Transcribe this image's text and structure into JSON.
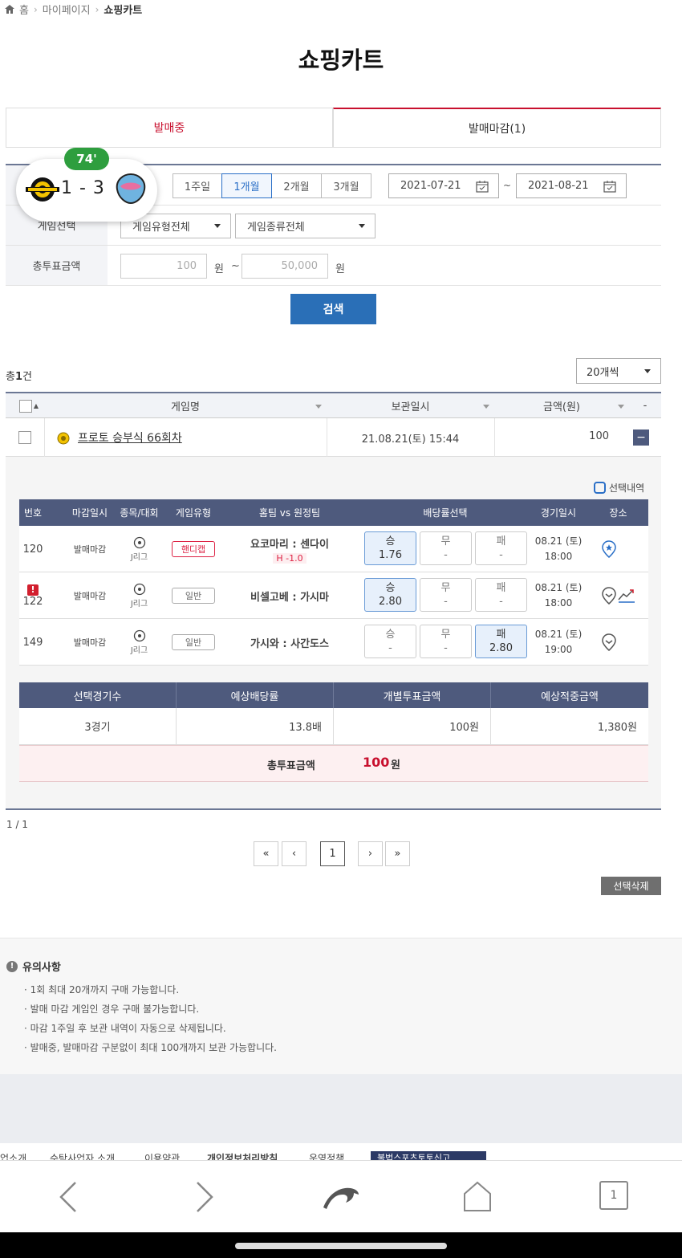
{
  "breadcrumb": {
    "home": "홈",
    "mypage": "마이페이지",
    "current": "쇼핑카트"
  },
  "page_title": "쇼핑카트",
  "tabs": [
    {
      "label": "발매중"
    },
    {
      "label": "발매마감(1)"
    }
  ],
  "live_score": {
    "minute": "74'",
    "score": "1 - 3"
  },
  "filter": {
    "periods": [
      "1주일",
      "1개월",
      "2개월",
      "3개월"
    ],
    "selected_period": "1개월",
    "date_from": "2021-07-21",
    "date_sep": "~",
    "date_to": "2021-08-21",
    "game_select_label": "게임선택",
    "game_type": "게임유형전체",
    "game_kind": "게임종류전체",
    "amount_label": "총투표금액",
    "amount_min_placeholder": "100",
    "amount_max_placeholder": "50,000",
    "unit": "원",
    "range_sep": "~",
    "search_button": "검색"
  },
  "list": {
    "total_prefix": "총",
    "total_count": "1",
    "total_suffix": "건",
    "per_page": "20개씩",
    "headers": {
      "name": "게임명",
      "saved": "보관일시",
      "amount": "금액(원)",
      "minus": "-"
    },
    "row": {
      "name": "프로토 승부식 66회차",
      "saved": "21.08.21(토) 15:44",
      "amount": "100",
      "collapse": "−"
    }
  },
  "detail": {
    "selected_history": "선택내역",
    "headers": [
      "번호",
      "마감일시",
      "종목/대회",
      "게임유형",
      "홈팀 vs 원정팀",
      "배당률선택",
      "경기일시",
      "장소"
    ],
    "games": [
      {
        "no": "120",
        "status": "발매마감",
        "league": "J리그",
        "type": "핸디캡",
        "match": "요코마리 : 센다이",
        "handicap": "H -1.0",
        "odds": [
          {
            "label": "승",
            "value": "1.76",
            "on": true
          },
          {
            "label": "무",
            "value": "-",
            "on": false
          },
          {
            "label": "패",
            "value": "-",
            "on": false
          }
        ],
        "date": "08.21 (토)",
        "time": "18:00"
      },
      {
        "no": "122",
        "status": "발매마감",
        "league": "J리그",
        "type": "일반",
        "match": "비셀고베 : 가시마",
        "handicap": "",
        "odds": [
          {
            "label": "승",
            "value": "2.80",
            "on": true
          },
          {
            "label": "무",
            "value": "-",
            "on": false
          },
          {
            "label": "패",
            "value": "-",
            "on": false
          }
        ],
        "date": "08.21 (토)",
        "time": "18:00"
      },
      {
        "no": "149",
        "status": "발매마감",
        "league": "J리그",
        "type": "일반",
        "match": "가시와 : 사간도스",
        "handicap": "",
        "odds": [
          {
            "label": "승",
            "value": "-",
            "on": false
          },
          {
            "label": "무",
            "value": "-",
            "on": false
          },
          {
            "label": "패",
            "value": "2.80",
            "on": true
          }
        ],
        "date": "08.21 (토)",
        "time": "19:00"
      }
    ],
    "summary_headers": [
      "선택경기수",
      "예상배당률",
      "개별투표금액",
      "예상적중금액"
    ],
    "summary_values": [
      "3경기",
      "13.8배",
      "100원",
      "1,380원"
    ],
    "total_label": "총투표금액",
    "total_amount": "100",
    "total_unit": "원"
  },
  "pager": {
    "info": "1 / 1",
    "first": "«",
    "prev": "‹",
    "page": "1",
    "next": "›",
    "last": "»"
  },
  "delete_selected": "선택삭제",
  "notice": {
    "title": "유의사항",
    "items": [
      "1회 최대 20개까지 구매 가능합니다.",
      "발매 마감 게임인 경우 구매 불가능합니다.",
      "마감 1주일 후 보관 내역이 자동으로 삭제됩니다.",
      "발매중, 발매마감 구분없이 최대 100개까지 보관 가능합니다."
    ]
  },
  "footer_links": [
    "업소개",
    "수탁사업자 소개",
    "이용약관",
    "개인정보처리방침",
    "운영정책",
    "불법스포츠토토신고"
  ],
  "browser": {
    "tab_count": "1"
  },
  "colors": {
    "accent_red": "#c8102e",
    "navy": "#4e5a7d",
    "blue": "#2a6fb7",
    "live_green": "#2e9e3e"
  }
}
